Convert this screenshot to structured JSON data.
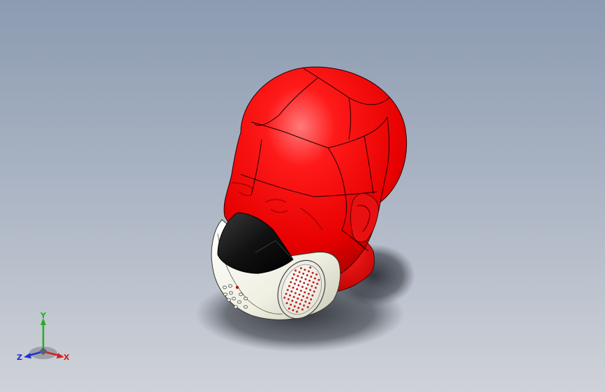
{
  "viewport": {
    "background_top": "#8c9bb1",
    "background_bottom": "#cfd2d8"
  },
  "model": {
    "head_color": "#ff0000",
    "mask_shell_color": "#efefe2",
    "mask_nose_color": "#111111",
    "filter_dot_color": "#c02020"
  },
  "triad": {
    "x_label": "X",
    "y_label": "Y",
    "z_label": "Z",
    "x_color": "#d42020",
    "y_color": "#22b022",
    "z_color": "#2030d0"
  }
}
